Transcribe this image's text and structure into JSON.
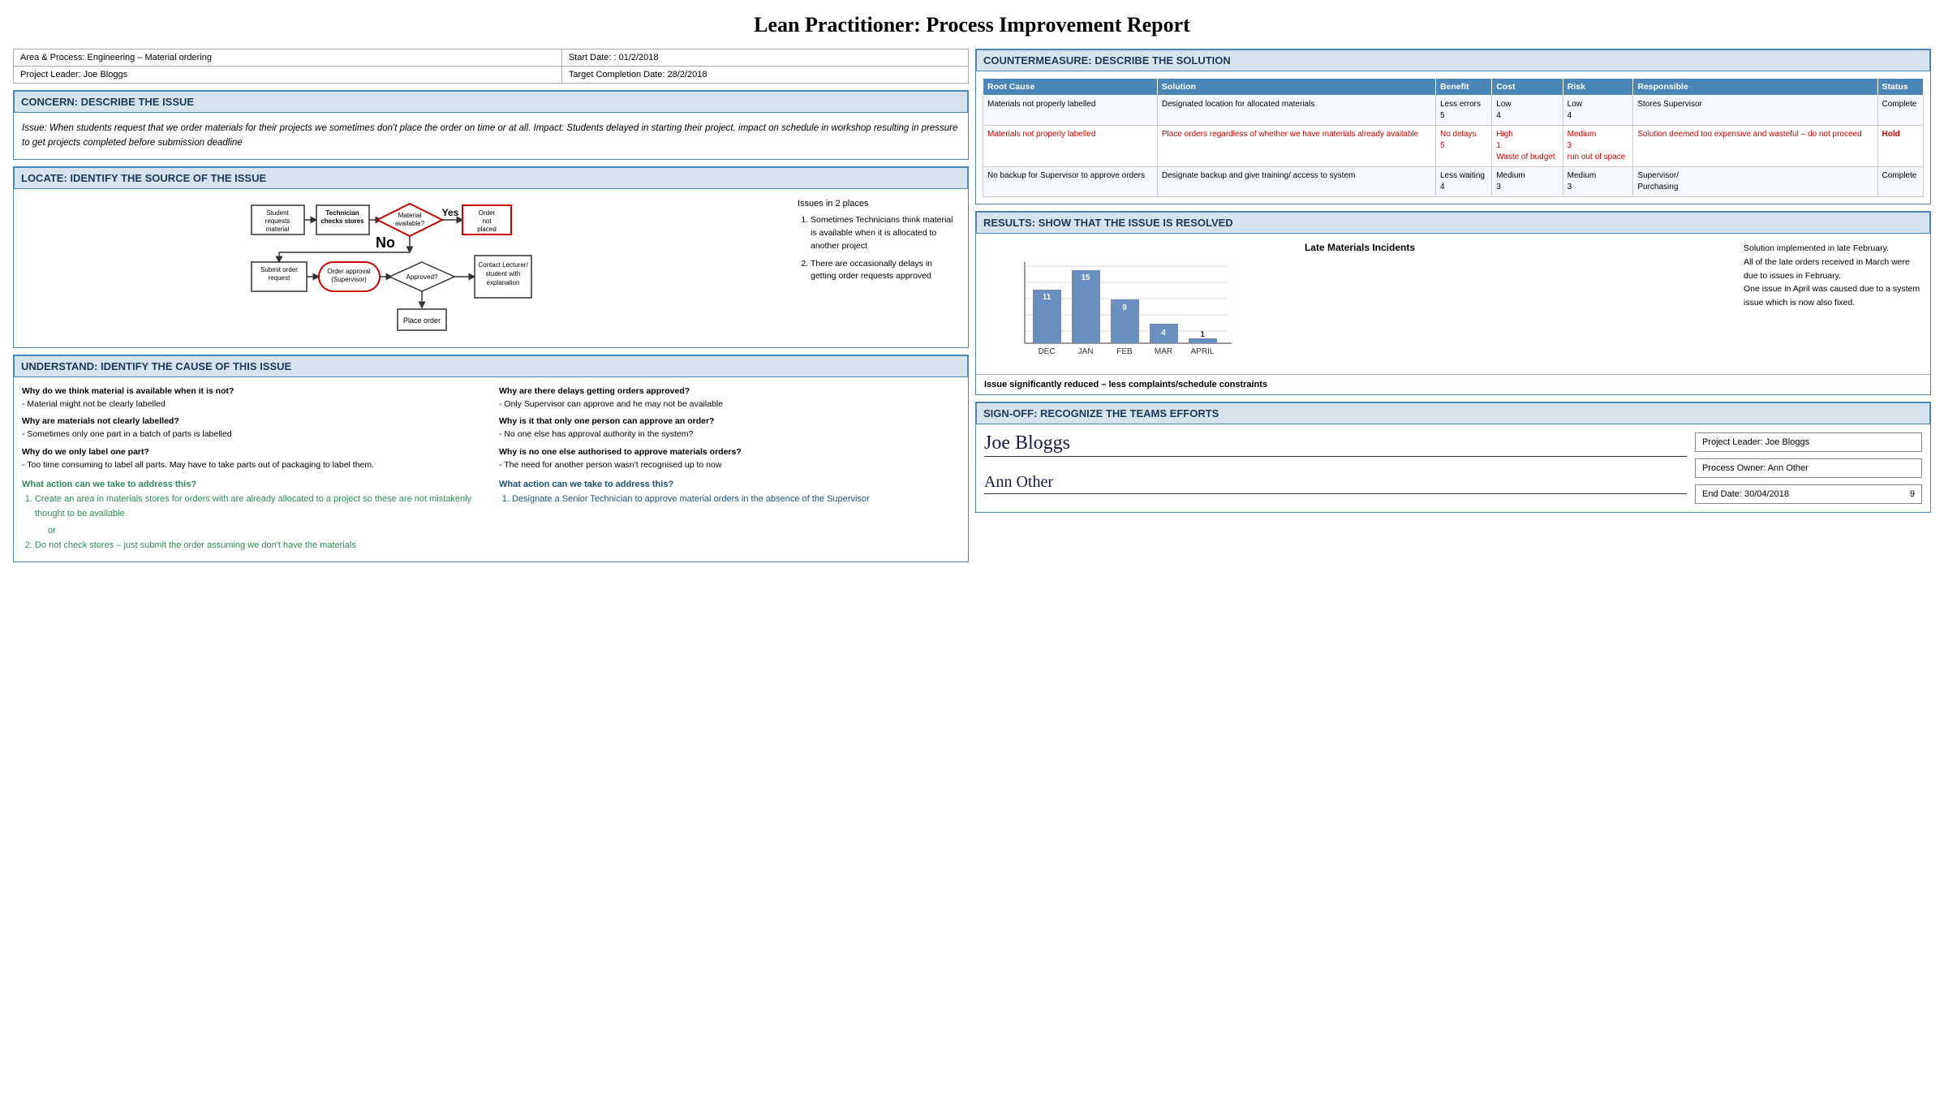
{
  "title": "Lean Practitioner: Process Improvement Report",
  "header": {
    "area": "Area & Process: Engineering – Material ordering",
    "start_date": "Start Date: : 01/2/2018",
    "project_leader": "Project Leader: Joe Bloggs",
    "target_completion": "Target Completion Date: 28/2/2018"
  },
  "concern": {
    "heading": "CONCERN: DESCRIBE THE ISSUE",
    "text": "Issue: When students request that we order materials for their projects we sometimes don't place the order on time or at all.\nImpact:  Students delayed in starting their project, impact on schedule in workshop resulting in pressure to get projects completed before submission deadline"
  },
  "locate": {
    "heading": "LOCATE: IDENTIFY THE SOURCE OF THE ISSUE",
    "flow_nodes": [
      "Student requests material",
      "Technician checks stores",
      "Material available?",
      "Order not placed",
      "Submit order request",
      "Order approval (Supervisor)",
      "Approved?",
      "Contact Lecturer/student with explanation",
      "Place order"
    ],
    "issues_title": "Issues in 2 places",
    "issues": [
      "Sometimes Technicians think material is available when it is allocated to another project",
      "There are occasionally delays in getting order requests approved"
    ]
  },
  "understand": {
    "heading": "UNDERSTAND: IDENTIFY THE CAUSE OF THIS ISSUE",
    "col1": [
      {
        "question": "Why do we think material is available when it is not?",
        "answer": "- Material might not be clearly labelled"
      },
      {
        "question": "Why are materials not clearly labelled?",
        "answer": "- Sometimes only one part in a batch of parts is labelled"
      },
      {
        "question": "Why do we only label one part?",
        "answer": "- Too time consuming to label all parts. May have to take parts out of packaging to label them."
      }
    ],
    "col2": [
      {
        "question": "Why are there delays getting orders approved?",
        "answer": "- Only Supervisor can approve and he may not be available"
      },
      {
        "question": "Why is it that only one person can approve an order?",
        "answer": "- No one else has approval authority in the system?"
      },
      {
        "question": "Why is no one else authorised to approve materials orders?",
        "answer": "- The need for another person wasn't recognised up to now"
      }
    ],
    "action1_heading": "What action can we take to address this?",
    "action1_items": [
      "Create an area in materials stores for orders with are already allocated to a project so these are not mistakenly thought to be available",
      "Do not check stores – just submit the order assuming we don't have the materials"
    ],
    "action1_connector": "or",
    "action2_heading": "What action can we take to address this?",
    "action2_items": [
      "Designate a Senior Technician to approve material orders in the absence of the Supervisor"
    ]
  },
  "countermeasure": {
    "heading": "COUNTERMEASURE: DESCRIBE THE SOLUTION",
    "columns": [
      "Root Cause",
      "Solution",
      "Benefit",
      "Cost",
      "Risk",
      "Responsible",
      "Status"
    ],
    "rows": [
      {
        "root_cause": "Materials not properly labelled",
        "solution": "Designated location for allocated materials",
        "benefit": "Less errors\n5",
        "cost": "Low\n4",
        "risk": "Low\n4",
        "responsible": "Stores Supervisor",
        "status": "Complete",
        "highlight": false
      },
      {
        "root_cause": "Materials not properly labelled",
        "solution": "Place orders regardless of whether we have materials already available",
        "benefit": "No delays\n5",
        "cost": "High\n1\nWaste of budget",
        "risk": "Medium\n3\nrun out of space",
        "responsible": "Solution deemed too expensive and wasteful – do not proceed",
        "status": "Hold",
        "highlight": true
      },
      {
        "root_cause": "No backup for Supervisor to approve orders",
        "solution": "Designate backup and give training/ access to system",
        "benefit": "Less waiting\n4",
        "cost": "Medium\n3",
        "risk": "Medium\n3",
        "responsible": "Supervisor/\nPurchasing",
        "status": "Complete",
        "highlight": false
      }
    ]
  },
  "results": {
    "heading": "RESULTS: SHOW THAT THE ISSUE IS RESOLVED",
    "chart_title": "Late Materials Incidents",
    "bars": [
      {
        "label": "DEC",
        "value": 11,
        "height_pct": 73
      },
      {
        "label": "JAN",
        "value": 15,
        "height_pct": 100
      },
      {
        "label": "FEB",
        "value": 9,
        "height_pct": 60
      },
      {
        "label": "MAR",
        "value": 4,
        "height_pct": 27
      },
      {
        "label": "APRIL",
        "value": 1,
        "height_pct": 7
      }
    ],
    "narrative": "Solution implemented in late February.\nAll of the late orders received in March were due to issues in February.\nOne issue in April was caused due to a system issue which is now also fixed.",
    "summary": "Issue significantly reduced – less complaints/schedule constraints"
  },
  "signoff": {
    "heading": "SIGN-OFF: RECOGNIZE THE TEAMS EFFORTS",
    "sig1": "Joe Bloggs",
    "sig2": "Ann Other",
    "project_leader": "Project Leader: Joe Bloggs",
    "process_owner": "Process Owner: Ann Other",
    "end_date_label": "End Date: 30/04/2018",
    "end_date_num": "9"
  }
}
